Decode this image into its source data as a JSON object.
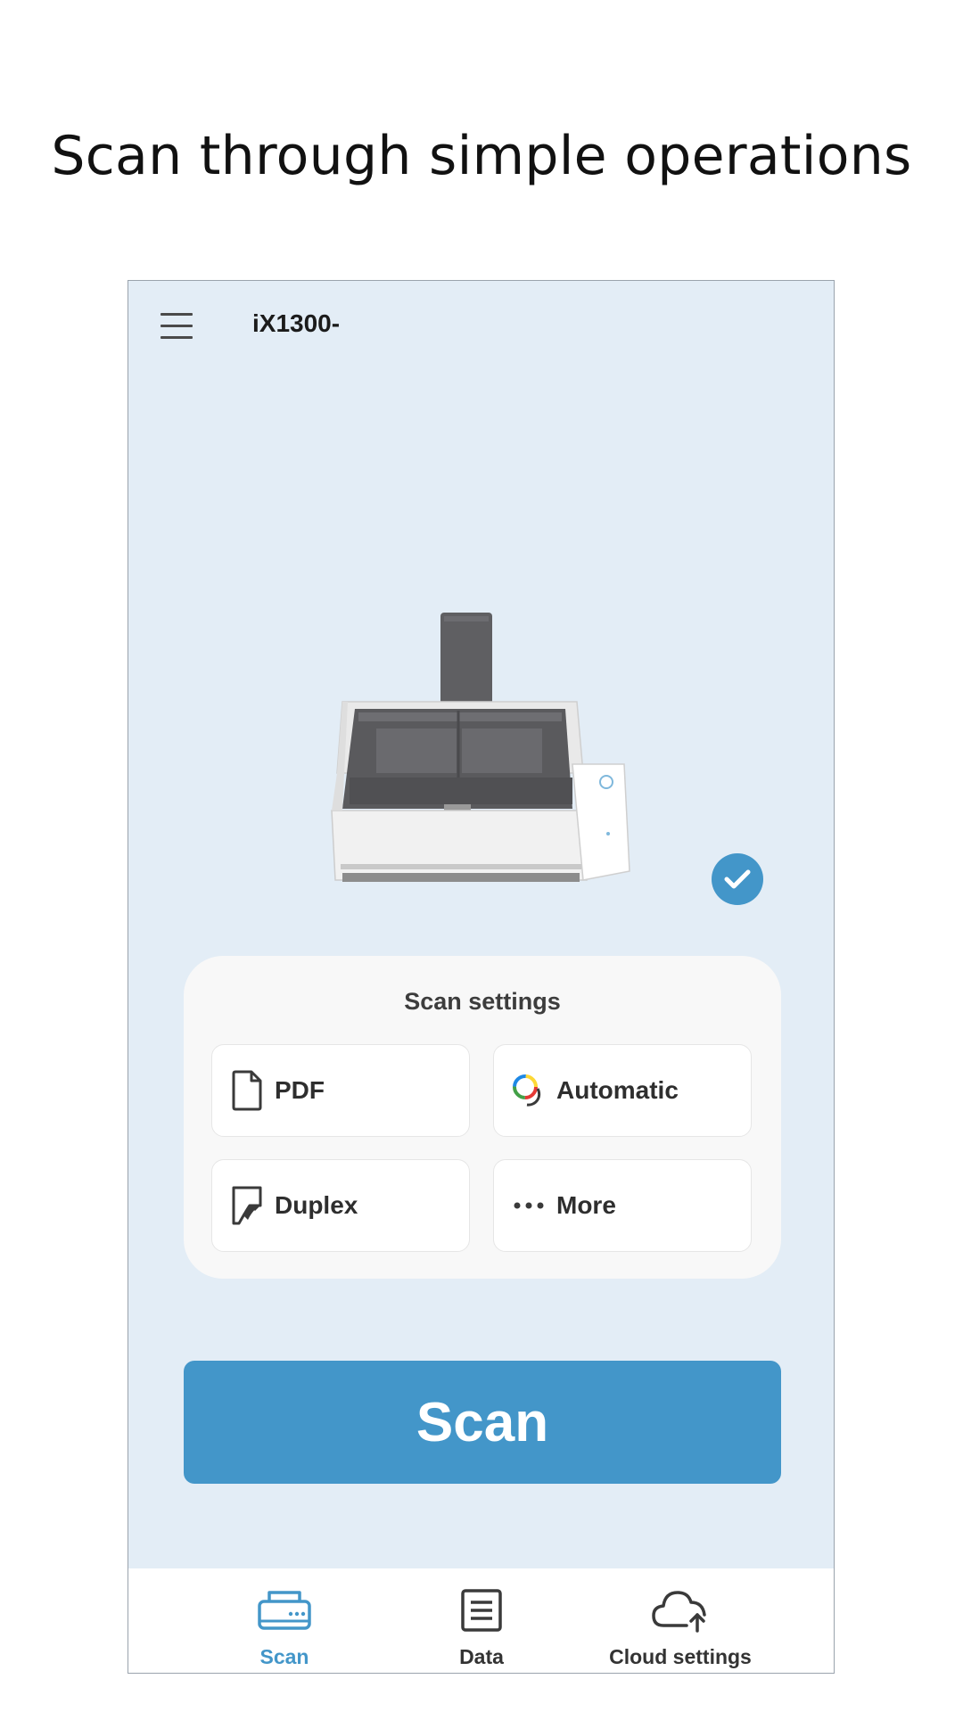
{
  "headline": "Scan through simple operations",
  "app_bar": {
    "menu_icon": "hamburger-menu-icon",
    "device_name": "iX1300-"
  },
  "scanner": {
    "image": "scanner-illustration",
    "status_icon": "check-circle-icon"
  },
  "scan_settings": {
    "title": "Scan settings",
    "options": [
      {
        "label": "PDF",
        "icon": "document-icon"
      },
      {
        "label": "Automatic",
        "icon": "color-mode-icon"
      },
      {
        "label": "Duplex",
        "icon": "duplex-icon"
      },
      {
        "label": "More",
        "icon": "more-dots-icon"
      }
    ]
  },
  "scan_button": {
    "label": "Scan"
  },
  "bottom_nav": {
    "items": [
      {
        "label": "Scan",
        "icon": "scanner-icon",
        "active": true
      },
      {
        "label": "Data",
        "icon": "data-list-icon",
        "active": false
      },
      {
        "label": "Cloud settings",
        "icon": "cloud-upload-icon",
        "active": false
      }
    ]
  },
  "colors": {
    "accent": "#4396c9",
    "screen_background": "#e3edf6",
    "card_background": "#f8f8f8"
  }
}
